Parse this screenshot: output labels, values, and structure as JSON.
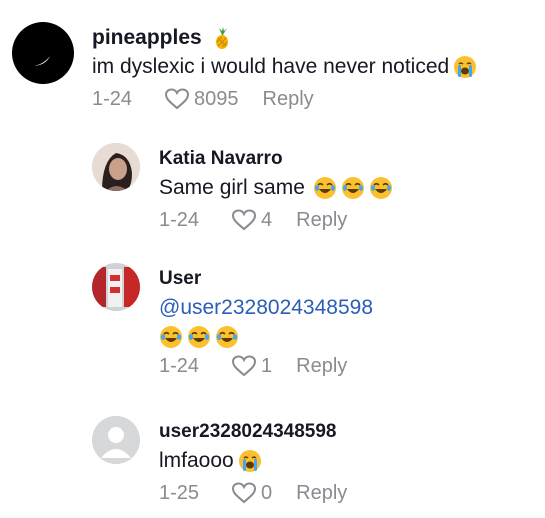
{
  "comments": [
    {
      "username": "pineapples",
      "username_emoji": "pineapple-emoji",
      "text": "im dyslexic i would have never noticed",
      "text_emojis": [
        "loudly-crying-face-emoji"
      ],
      "date": "1-24",
      "likes": "8095",
      "reply_label": "Reply"
    },
    {
      "username": "Katia Navarro",
      "text": "Same girl same",
      "text_emojis": [
        "face-with-tears-of-joy-emoji",
        "face-with-tears-of-joy-emoji",
        "face-with-tears-of-joy-emoji"
      ],
      "date": "1-24",
      "likes": "4",
      "reply_label": "Reply"
    },
    {
      "username": "User",
      "mention": "@user2328024348598",
      "text_emojis": [
        "face-with-tears-of-joy-emoji",
        "face-with-tears-of-joy-emoji",
        "face-with-tears-of-joy-emoji"
      ],
      "date": "1-24",
      "likes": "1",
      "reply_label": "Reply"
    },
    {
      "username": "user2328024348598",
      "text": "lmfaooo",
      "text_emojis": [
        "loudly-crying-face-emoji"
      ],
      "date": "1-25",
      "likes": "0",
      "reply_label": "Reply"
    }
  ],
  "colors": {
    "text": "#161823",
    "muted": "#8a8b91",
    "mention": "#2b5db9"
  }
}
